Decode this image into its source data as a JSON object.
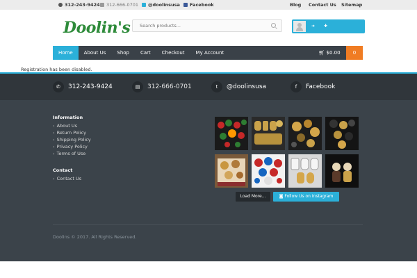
{
  "topbar": {
    "phone": "312-243-9424",
    "fax": "312-666-0701",
    "twitter": "@doolinsusa",
    "facebook": "Facebook",
    "links": [
      "Blog",
      "Contact Us",
      "Sitemap"
    ]
  },
  "header": {
    "logo_text": "Doolin's",
    "search_placeholder": "Search products..."
  },
  "nav": {
    "items": [
      "Home",
      "About Us",
      "Shop",
      "Cart",
      "Checkout",
      "My Account"
    ],
    "cart_total": "$0.00",
    "cart_count": "0"
  },
  "notice": "Registration has been disabled.",
  "contact_bar": {
    "phone": "312-243-9424",
    "fax": "312-666-0701",
    "twitter": "@doolinsusa",
    "facebook": "Facebook"
  },
  "footer": {
    "information_heading": "Information",
    "information_links": [
      "About Us",
      "Return Policy",
      "Shipping Policy",
      "Privacy Policy",
      "Terms of Use"
    ],
    "contact_heading": "Contact",
    "contact_links": [
      "Contact Us"
    ],
    "load_more": "Load More...",
    "follow_instagram": "Follow Us on Instagram",
    "copyright": "Doolins © 2017. All Rights Reserved."
  },
  "colors": {
    "accent": "#2bb0d9",
    "cart_orange": "#f07c23",
    "logo_green": "#2e8b3a",
    "footer_bg": "#3b434a"
  }
}
